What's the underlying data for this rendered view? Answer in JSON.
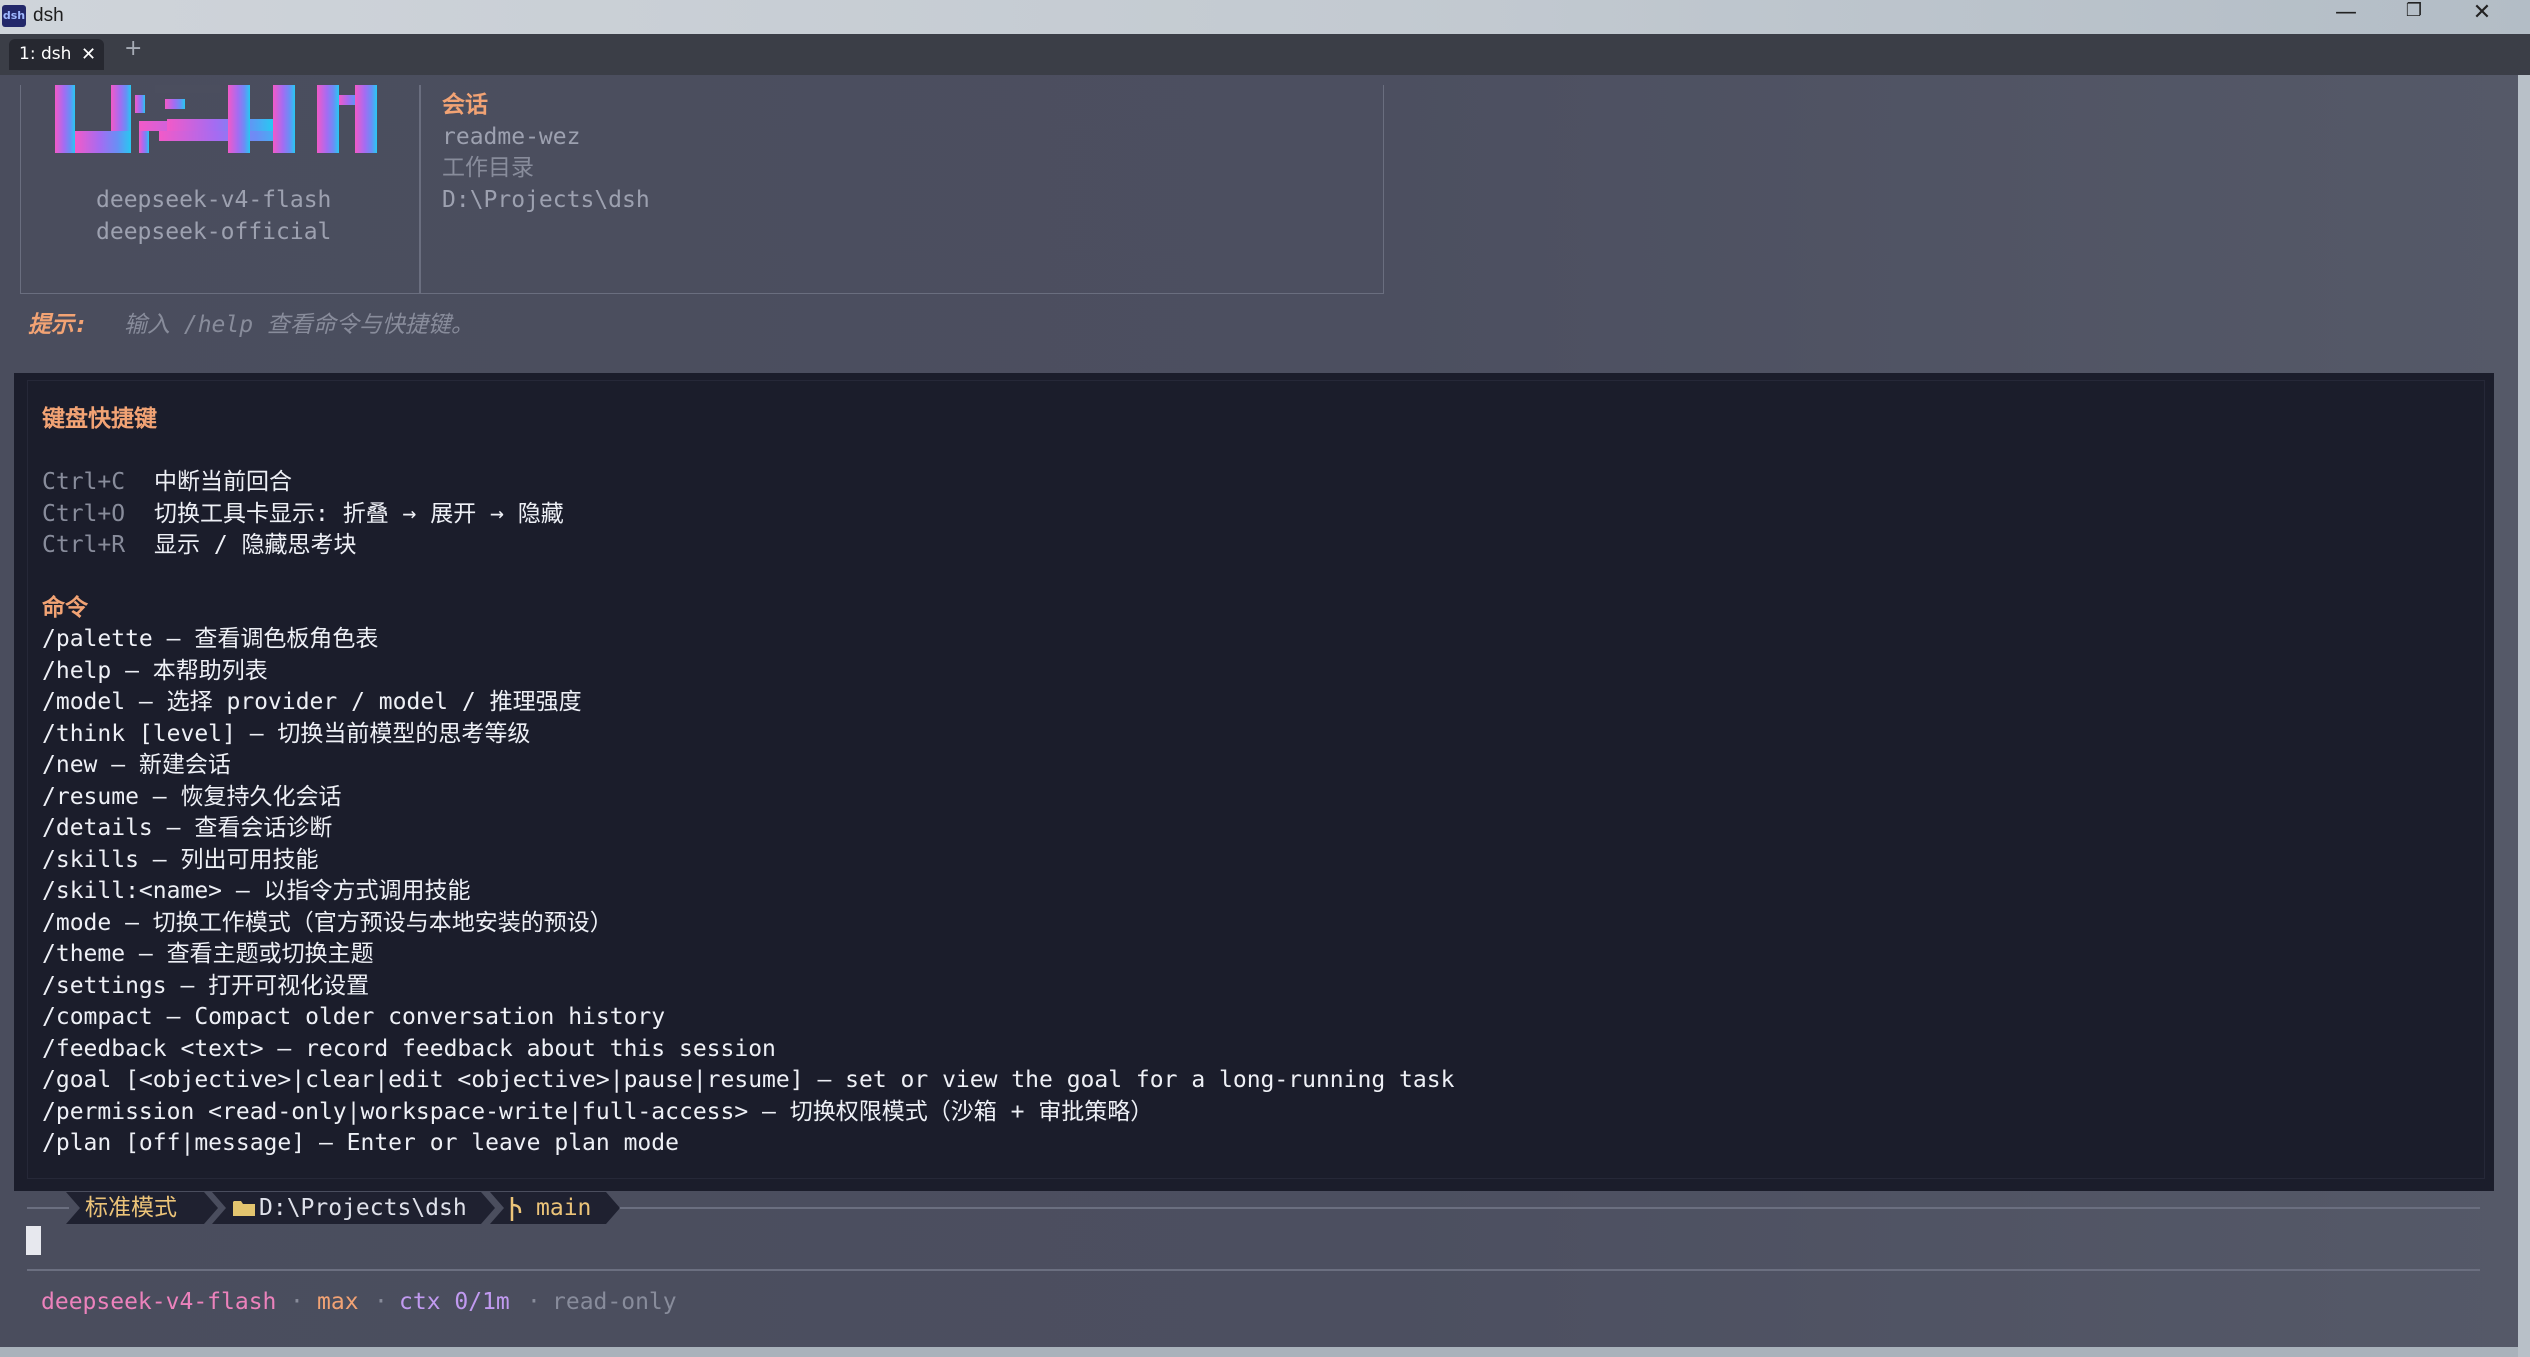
{
  "window": {
    "title": "dsh",
    "minimize_icon": "—",
    "restore_icon": "❐",
    "close_icon": "✕"
  },
  "tabbar": {
    "tab_label": "1: dsh",
    "tab_close": "✕",
    "new_tab": "+"
  },
  "header": {
    "model": "deepseek-v4-flash",
    "provider": "deepseek-official",
    "session_heading": "会话",
    "session_name": "readme-wez",
    "workdir_heading": "工作目录",
    "workdir": "D:\\Projects\\dsh"
  },
  "hint": {
    "label": "提示:",
    "text": "输入 /help 查看命令与快捷键。"
  },
  "help": {
    "shortcuts_title": "键盘快捷键",
    "shortcuts": [
      {
        "key": "Ctrl+C",
        "desc": "中断当前回合"
      },
      {
        "key": "Ctrl+O",
        "desc": "切换工具卡显示: 折叠 → 展开 → 隐藏"
      },
      {
        "key": "Ctrl+R",
        "desc": "显示 / 隐藏思考块"
      }
    ],
    "commands_title": "命令",
    "commands": [
      "/palette — 查看调色板角色表",
      "/help — 本帮助列表",
      "/model — 选择 provider / model / 推理强度",
      "/think [level] — 切换当前模型的思考等级",
      "/new — 新建会话",
      "/resume — 恢复持久化会话",
      "/details — 查看会话诊断",
      "/skills — 列出可用技能",
      "/skill:<name> — 以指令方式调用技能",
      "/mode — 切换工作模式（官方预设与本地安装的预设）",
      "/theme — 查看主题或切换主题",
      "/settings — 打开可视化设置",
      "/compact — Compact older conversation history",
      "/feedback <text> — record feedback about this session",
      "/goal [<objective>|clear|edit <objective>|pause|resume] — set or view the goal for a long-running task",
      "/permission <read-only|workspace-write|full-access> — 切换权限模式（沙箱 + 审批策略）",
      "/plan [off|message] — Enter or leave plan mode"
    ]
  },
  "statusline": {
    "mode": "标准模式",
    "folder_icon": "folder-icon",
    "path": "D:\\Projects\\dsh",
    "branch_icon": "git-branch-icon",
    "branch": "main"
  },
  "footer": {
    "model": "deepseek-v4-flash",
    "sep1": "·",
    "effort": "max",
    "sep2": "·",
    "ctx": "ctx 0/1m",
    "sep3": "·",
    "permission": "read-only"
  },
  "colors": {
    "accent_orange": "#f2a374",
    "accent_pink": "#ec82bc",
    "accent_purple": "#c19af0",
    "accent_yellow": "#ecc479",
    "panel_bg": "#1b1d2b",
    "terminal_bg": "#4a4d5d"
  }
}
